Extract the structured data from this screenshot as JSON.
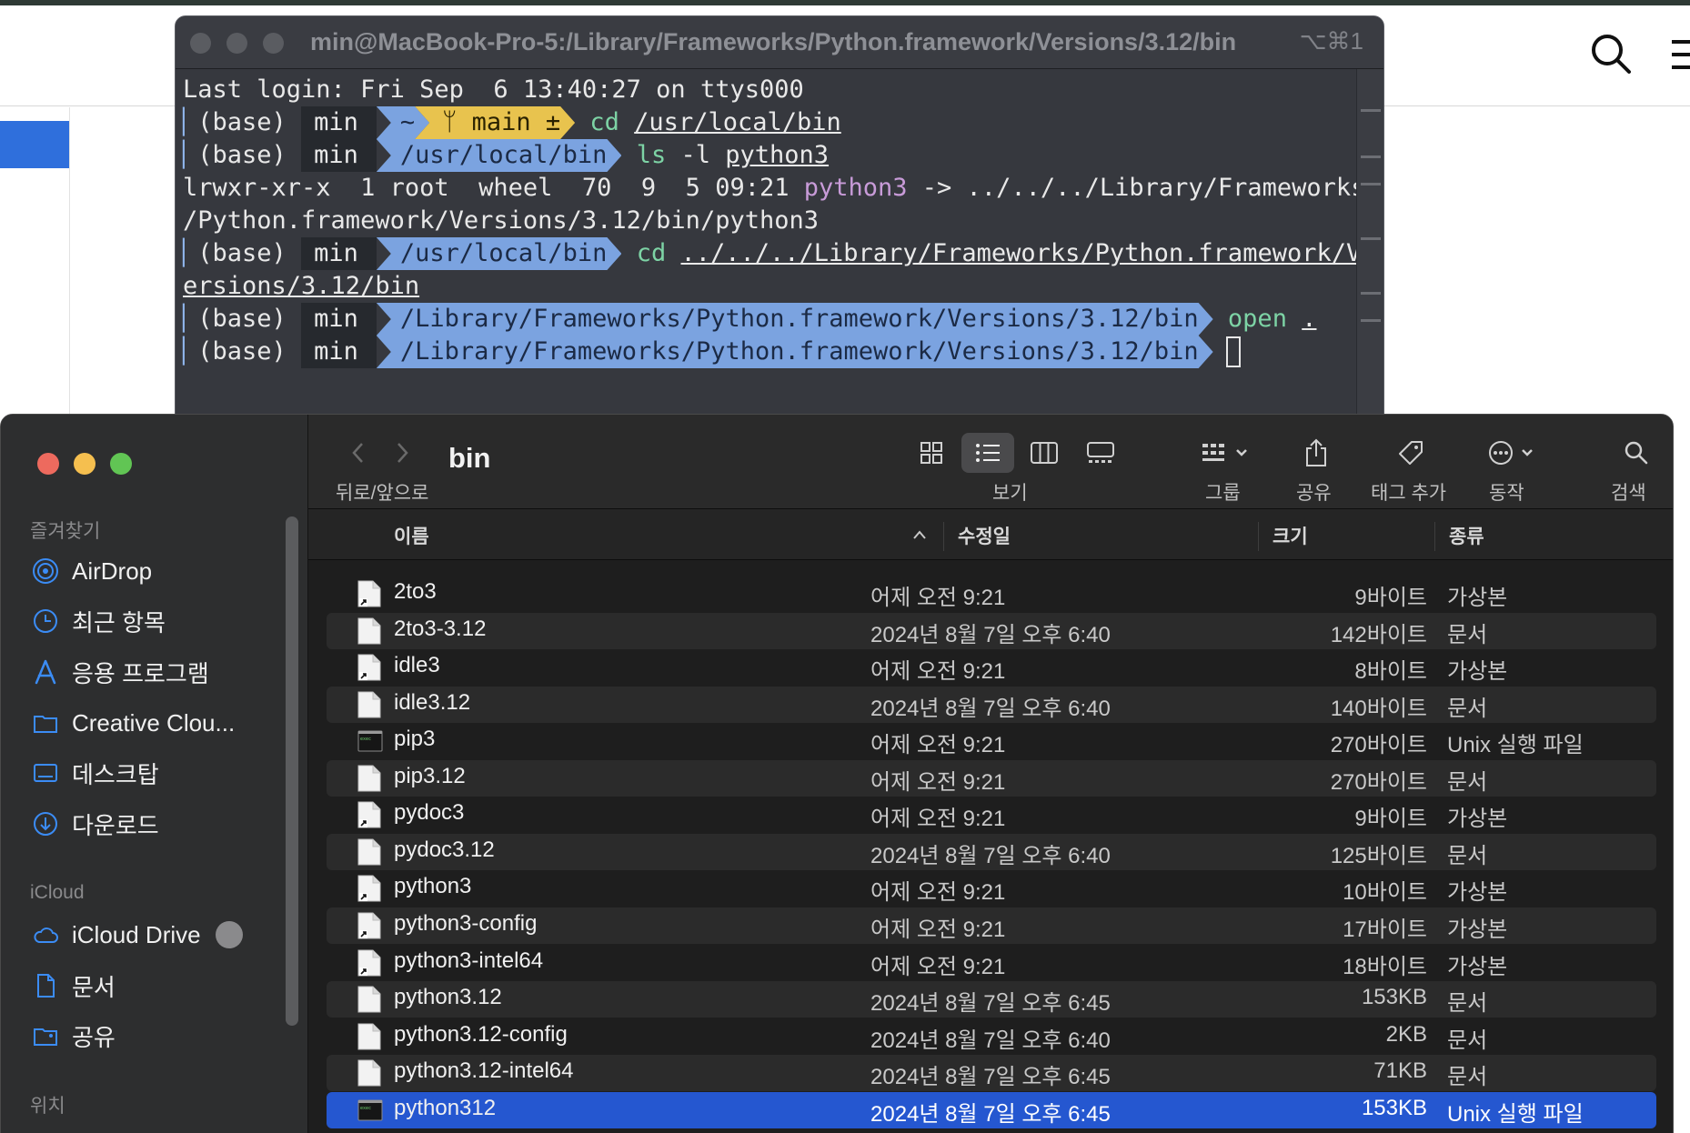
{
  "terminal": {
    "title": "min@MacBook-Pro-5:/Library/Frameworks/Python.framework/Versions/3.12/bin",
    "shortcut": "⌥⌘1",
    "last_login": "Last login: Fri Sep  6 13:40:27 on ttys000",
    "env": "(base)",
    "user": "min",
    "home_dir": "~",
    "git_branch": "ᛘ main ±",
    "dir_usr_local_bin": "/usr/local/bin",
    "dir_long": "/Library/Frameworks/Python.framework/Versions/3.12/bin",
    "cmd_cd": "cd",
    "cmd_ls": "ls",
    "cmd_open": "open",
    "arg_usr_local_bin": "/usr/local/bin",
    "flag_l": "-l",
    "arg_python3": "python3",
    "ls_output_prefix": "lrwxr-xr-x  1 root  wheel  70  9  5 09:21 ",
    "ls_output_link": "python3",
    "ls_output_suffix": " -> ../../../Library/Frameworks",
    "ls_output_line2": "/Python.framework/Versions/3.12/bin/python3",
    "arg_rel_path_1": "../../../Library/Frameworks/Python.framework/V",
    "arg_rel_path_2": "ersions/3.12/bin",
    "arg_dot": "."
  },
  "finder": {
    "toolbar": {
      "folder_title": "bin",
      "back_forward_label": "뒤로/앞으로",
      "view_label": "보기",
      "group_label": "그룹",
      "share_label": "공유",
      "tag_label": "태그 추가",
      "action_label": "동작",
      "search_label": "검색"
    },
    "sidebar": {
      "favorites_header": "즐겨찾기",
      "favorites": [
        "AirDrop",
        "최근 항목",
        "응용 프로그램",
        "Creative Clou...",
        "데스크탑",
        "다운로드"
      ],
      "icloud_header": "iCloud",
      "icloud": [
        "iCloud Drive",
        "문서",
        "공유"
      ],
      "locations_header": "위치"
    },
    "columns": {
      "name": "이름",
      "date": "수정일",
      "size": "크기",
      "kind": "종류"
    },
    "files": [
      {
        "name": "2to3",
        "date": "어제 오전 9:21",
        "size": "9바이트",
        "kind": "가상본",
        "icon": "alias-icon"
      },
      {
        "name": "2to3-3.12",
        "date": "2024년 8월 7일 오후 6:40",
        "size": "142바이트",
        "kind": "문서",
        "icon": "document-icon"
      },
      {
        "name": "idle3",
        "date": "어제 오전 9:21",
        "size": "8바이트",
        "kind": "가상본",
        "icon": "alias-icon"
      },
      {
        "name": "idle3.12",
        "date": "2024년 8월 7일 오후 6:40",
        "size": "140바이트",
        "kind": "문서",
        "icon": "document-icon"
      },
      {
        "name": "pip3",
        "date": "어제 오전 9:21",
        "size": "270바이트",
        "kind": "Unix 실행 파일",
        "icon": "unix-executable-icon"
      },
      {
        "name": "pip3.12",
        "date": "어제 오전 9:21",
        "size": "270바이트",
        "kind": "문서",
        "icon": "document-icon"
      },
      {
        "name": "pydoc3",
        "date": "어제 오전 9:21",
        "size": "9바이트",
        "kind": "가상본",
        "icon": "alias-icon"
      },
      {
        "name": "pydoc3.12",
        "date": "2024년 8월 7일 오후 6:40",
        "size": "125바이트",
        "kind": "문서",
        "icon": "document-icon"
      },
      {
        "name": "python3",
        "date": "어제 오전 9:21",
        "size": "10바이트",
        "kind": "가상본",
        "icon": "alias-icon"
      },
      {
        "name": "python3-config",
        "date": "어제 오전 9:21",
        "size": "17바이트",
        "kind": "가상본",
        "icon": "alias-icon"
      },
      {
        "name": "python3-intel64",
        "date": "어제 오전 9:21",
        "size": "18바이트",
        "kind": "가상본",
        "icon": "alias-icon"
      },
      {
        "name": "python3.12",
        "date": "2024년 8월 7일 오후 6:45",
        "size": "153KB",
        "kind": "문서",
        "icon": "document-icon"
      },
      {
        "name": "python3.12-config",
        "date": "2024년 8월 7일 오후 6:40",
        "size": "2KB",
        "kind": "문서",
        "icon": "document-icon"
      },
      {
        "name": "python3.12-intel64",
        "date": "2024년 8월 7일 오후 6:45",
        "size": "71KB",
        "kind": "문서",
        "icon": "document-icon"
      },
      {
        "name": "python312",
        "date": "2024년 8월 7일 오후 6:45",
        "size": "153KB",
        "kind": "Unix 실행 파일",
        "icon": "unix-executable-icon",
        "selected": true
      }
    ]
  },
  "colors": {
    "selection": "#2557d0",
    "prompt_blue": "#7ba3e0",
    "prompt_yellow": "#e8c34e",
    "command_green": "#7dd3a5",
    "traffic_red": "#ed6a5e",
    "traffic_yellow": "#f5bf4f",
    "traffic_green": "#61c554"
  }
}
